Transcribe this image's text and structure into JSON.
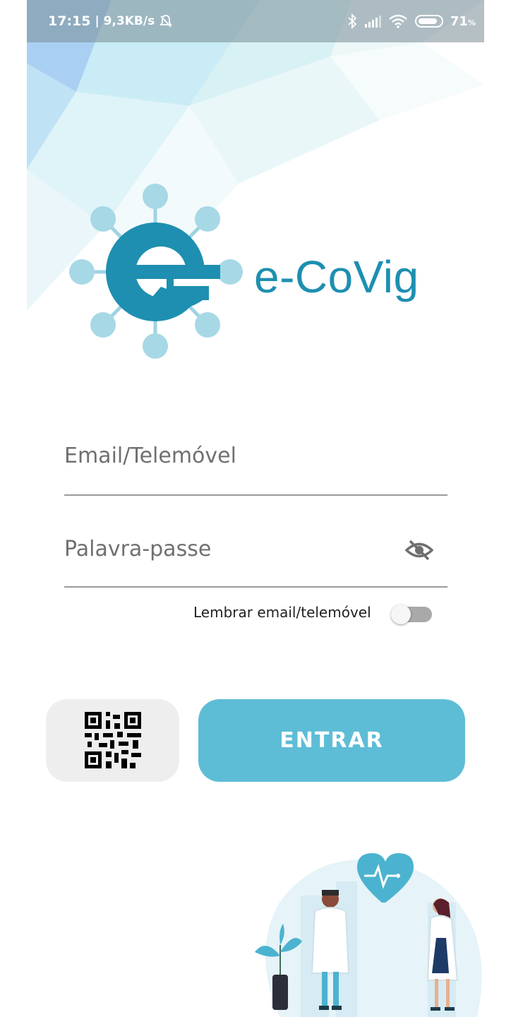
{
  "status_bar": {
    "time": "17:15",
    "network_speed": "| 9,3KB/s",
    "battery": "71",
    "battery_unit": "%",
    "icons": [
      "bell-off-icon",
      "bluetooth-icon",
      "signal-icon",
      "wifi-icon",
      "battery-icon"
    ]
  },
  "app": {
    "brand_name": "e-CoVig",
    "logo_icon": "virus-e-logo-icon",
    "accent_color": "#1e8fb0"
  },
  "login": {
    "email_placeholder": "Email/Telemóvel",
    "email_value": "",
    "password_placeholder": "Palavra-passe",
    "password_value": "",
    "password_toggle_icon": "eye-off-icon",
    "remember_label": "Lembrar email/telemóvel",
    "remember_enabled": false,
    "qr_button_icon": "qr-code-icon",
    "enter_button_label": "ENTRAR",
    "enter_button_color": "#5ebdd6"
  },
  "illustration": {
    "icon": "doctors-heart-illustration"
  }
}
